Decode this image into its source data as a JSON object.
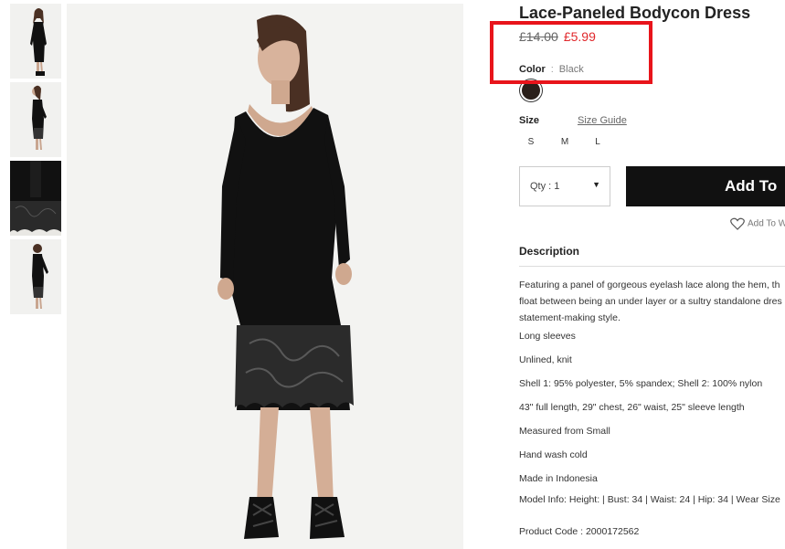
{
  "product": {
    "title": "Lace-Paneled Bodycon Dress",
    "price_original": "£14.00",
    "price_sale": "£5.99",
    "color_label": "Color",
    "color_separator": ":",
    "color_value": "Black",
    "swatch_color": "#2a1f1a",
    "size_label": "Size",
    "size_guide": "Size Guide",
    "sizes": [
      "S",
      "M",
      "L"
    ],
    "qty_label": "Qty : 1",
    "add_button": "Add To",
    "wishlist": "Add To W"
  },
  "description": {
    "heading": "Description",
    "lines": [
      "Featuring a panel of gorgeous eyelash lace along the hem, th",
      "float between being an under layer or a sultry standalone dres",
      "statement-making style."
    ],
    "items": [
      "Long sleeves",
      "Unlined, knit",
      "Shell 1: 95% polyester, 5% spandex; Shell 2: 100% nylon",
      "43\" full length, 29\" chest, 26\" waist, 25\" sleeve length",
      "Measured from Small",
      "Hand wash cold",
      "Made in Indonesia",
      "Model Info: Height: | Bust: 34 | Waist: 24 | Hip: 34 | Wear Size",
      "Product Code : 2000172562"
    ]
  },
  "colors": {
    "sale_price": "#e0272b",
    "highlight_border": "#e8141b",
    "button_bg": "#111111"
  }
}
